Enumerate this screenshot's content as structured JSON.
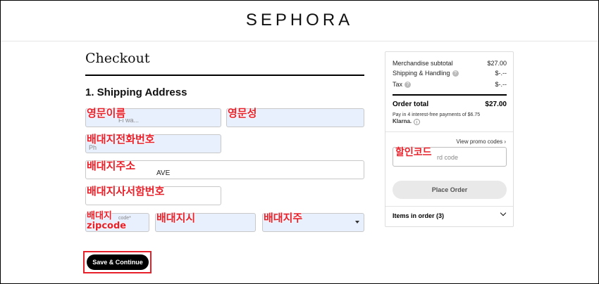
{
  "header": {
    "logo": "SEPHORA"
  },
  "page": {
    "title": "Checkout",
    "section_title": "1. Shipping Address"
  },
  "form": {
    "first_name": {
      "value": "",
      "annotation": "영문이름",
      "ghost": "Fi wa..."
    },
    "last_name": {
      "value": "",
      "annotation": "영문성"
    },
    "phone": {
      "value": "",
      "annotation": "배대지전화번호",
      "ghost": "Ph"
    },
    "address": {
      "value": "AVE",
      "annotation": "배대지주소"
    },
    "address2": {
      "value": "",
      "annotation": "배대지사서함번호"
    },
    "zip": {
      "ghost": "code*",
      "annotation_line1": "배대지",
      "annotation_line2": "zipcode"
    },
    "city": {
      "value": "",
      "annotation": "배대지시"
    },
    "state": {
      "value": "",
      "annotation": "배대지주"
    },
    "save_button": "Save & Continue"
  },
  "summary": {
    "merch_label": "Merchandise subtotal",
    "merch_amount": "$27.00",
    "shipping_label": "Shipping & Handling",
    "shipping_amount": "$-.--",
    "tax_label": "Tax",
    "tax_amount": "$-.--",
    "total_label": "Order total",
    "total_amount": "$27.00",
    "klarna_text": "Pay in 4 interest-free payments of $6.75",
    "klarna_brand": "Klarna.",
    "promo_link": "View promo codes",
    "promo_placeholder": "rd code",
    "promo_annotation": "할인코드",
    "place_order": "Place Order",
    "items_label": "Items in order (3)"
  },
  "colors": {
    "annotation": "#e8202a",
    "autofill": "#e8f0fe",
    "button": "#000000"
  }
}
